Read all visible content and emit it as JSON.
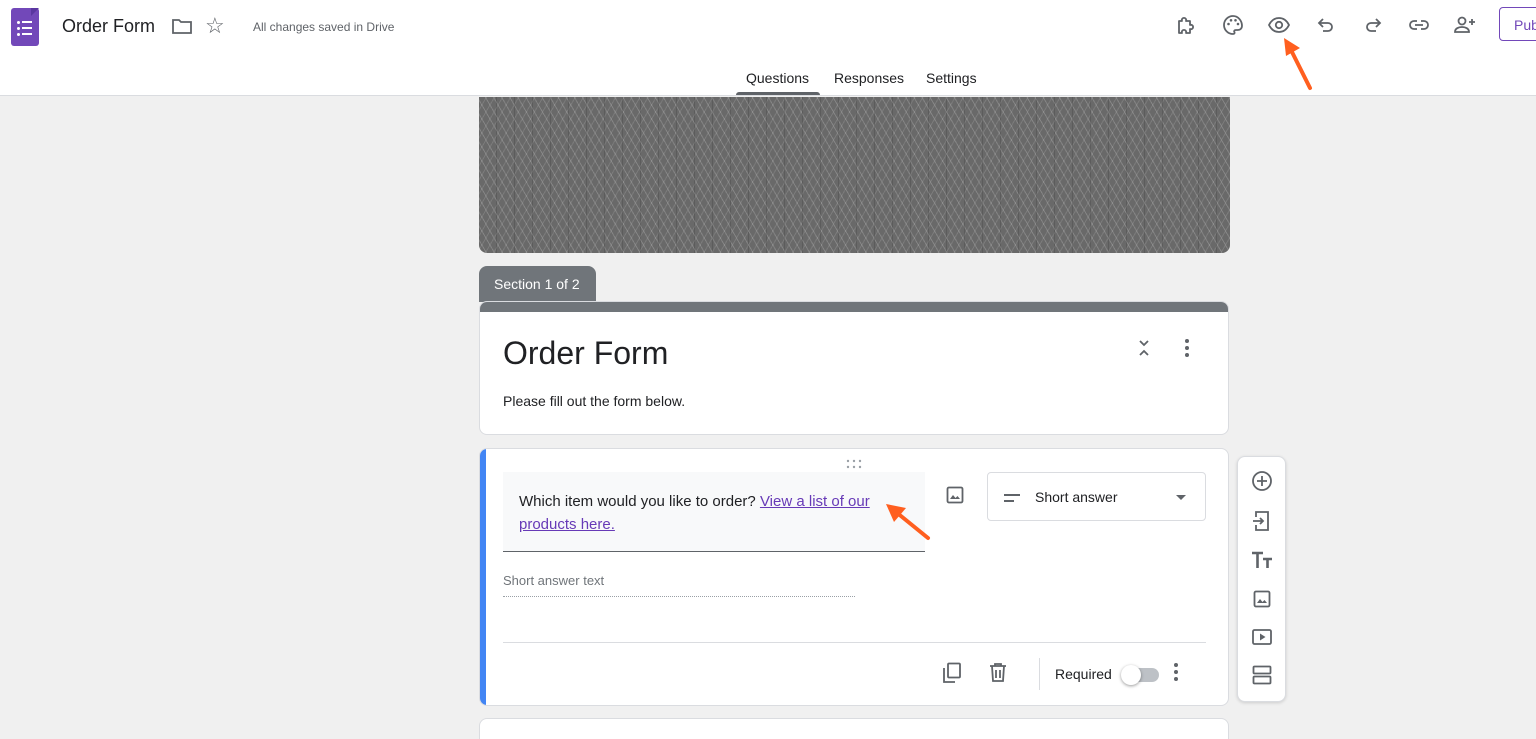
{
  "header": {
    "doc_title": "Order Form",
    "save_status": "All changes saved in Drive",
    "publish_label": "Pub"
  },
  "tabs": [
    {
      "label": "Questions",
      "active": true
    },
    {
      "label": "Responses",
      "active": false
    },
    {
      "label": "Settings",
      "active": false
    }
  ],
  "section": {
    "tag": "Section 1 of 2",
    "title": "Order Form",
    "description": "Please fill out the form below."
  },
  "question": {
    "text": "Which item would you like to order? ",
    "link_text": "View a list of our products here.",
    "type": "Short answer",
    "answer_placeholder": "Short answer text",
    "required_label": "Required",
    "required": false
  },
  "colors": {
    "accent": "#673ab7",
    "brand": "#7248b9",
    "active_bar": "#4285f4",
    "annotation": "#ff5f1f"
  },
  "icons": {
    "toolbar": [
      "puzzle-icon",
      "palette-icon",
      "eye-icon",
      "undo-icon",
      "redo-icon",
      "link-icon",
      "add-person-icon"
    ],
    "floating": [
      "add-question-icon",
      "import-questions-icon",
      "add-title-icon",
      "add-image-icon",
      "add-video-icon",
      "add-section-icon"
    ]
  }
}
